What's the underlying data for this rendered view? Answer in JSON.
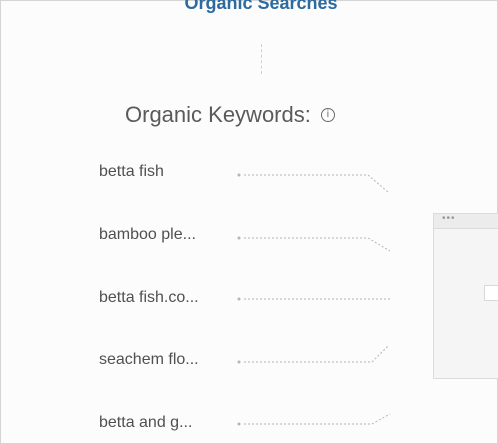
{
  "header": {
    "title": "Organic Searches"
  },
  "section": {
    "title": "Organic Keywords:",
    "info_icon": "info-icon"
  },
  "keywords": [
    {
      "label": "betta fish"
    },
    {
      "label": "bamboo ple..."
    },
    {
      "label": "betta fish.co..."
    },
    {
      "label": "seachem flo..."
    },
    {
      "label": "betta and g..."
    }
  ],
  "panel": {
    "handle": "•••"
  },
  "colors": {
    "title": "#2c6aa0",
    "text": "#505050",
    "connector": "#b5b5b5"
  }
}
